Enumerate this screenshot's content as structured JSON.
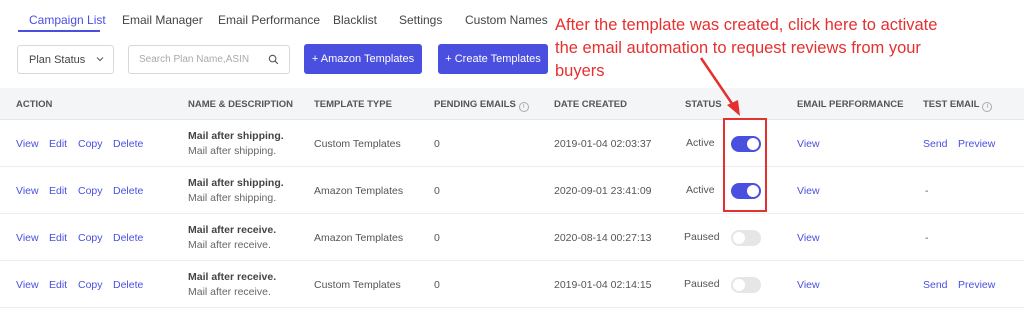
{
  "tabs": [
    {
      "label": "Campaign List",
      "active": true
    },
    {
      "label": "Email Manager"
    },
    {
      "label": "Email Performance"
    },
    {
      "label": "Blacklist"
    },
    {
      "label": "Settings"
    },
    {
      "label": "Custom Names"
    }
  ],
  "toolbar": {
    "plan_status": "Plan Status",
    "search_placeholder": "Search Plan Name,ASIN",
    "amazon_templates_label": "+ Amazon Templates",
    "create_templates_label": "+ Create Templates"
  },
  "annotation": {
    "line1": "After the template was created, click here to activate",
    "line2": "the email automation to request reviews from your",
    "line3": "buyers",
    "color": "#e53030"
  },
  "table": {
    "headers": {
      "action": "ACTION",
      "name": "NAME & DESCRIPTION",
      "template_type": "TEMPLATE TYPE",
      "pending": "PENDING EMAILS",
      "date_created": "DATE CREATED",
      "status": "STATUS",
      "performance": "EMAIL PERFORMANCE",
      "test_email": "TEST EMAIL"
    },
    "actions": {
      "view": "View",
      "edit": "Edit",
      "copy": "Copy",
      "delete": "Delete",
      "send": "Send",
      "preview": "Preview"
    },
    "rows": [
      {
        "name": "Mail after shipping.",
        "desc": "Mail after shipping.",
        "type": "Custom Templates",
        "pending": "0",
        "date": "2019-01-04 02:03:37",
        "status": "Active",
        "enabled": true,
        "performance": "View",
        "test_email": "send-preview"
      },
      {
        "name": "Mail after shipping.",
        "desc": "Mail after shipping.",
        "type": "Amazon Templates",
        "pending": "0",
        "date": "2020-09-01 23:41:09",
        "status": "Active",
        "enabled": true,
        "performance": "View",
        "test_email": "-"
      },
      {
        "name": "Mail after receive.",
        "desc": "Mail after receive.",
        "type": "Amazon Templates",
        "pending": "0",
        "date": "2020-08-14 00:27:13",
        "status": "Paused",
        "enabled": false,
        "performance": "View",
        "test_email": "-"
      },
      {
        "name": "Mail after receive.",
        "desc": "Mail after receive.",
        "type": "Custom Templates",
        "pending": "0",
        "date": "2019-01-04 02:14:15",
        "status": "Paused",
        "enabled": false,
        "performance": "View",
        "test_email": "send-preview"
      }
    ]
  },
  "colors": {
    "accent": "#4a4fe0",
    "annotation": "#e53030"
  }
}
